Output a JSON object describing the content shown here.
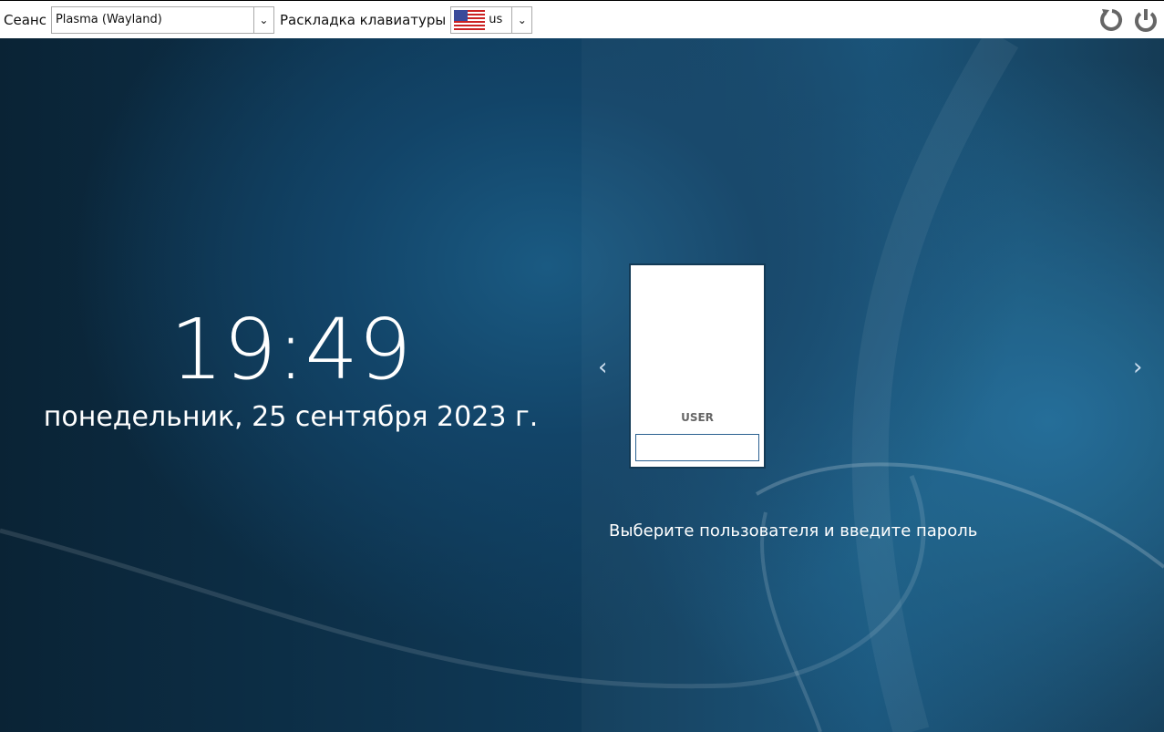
{
  "topbar": {
    "session_label": "Сеанс",
    "session_value": "Plasma (Wayland)",
    "layout_label": "Раскладка клавиатуры",
    "layout_value": "us"
  },
  "clock": {
    "time": "19:49",
    "date": "понедельник, 25 сентября 2023 г."
  },
  "users": [
    {
      "name": "USER"
    }
  ],
  "hint": "Выберите пользователя и введите пароль",
  "nav": {
    "prev": "‹",
    "next": "›"
  }
}
